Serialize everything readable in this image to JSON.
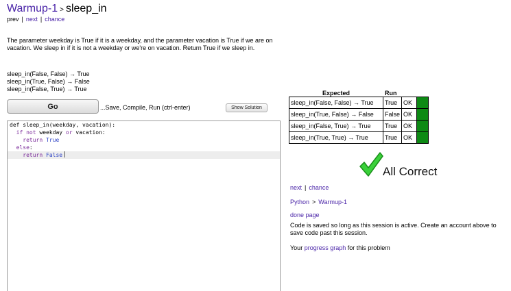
{
  "header": {
    "section": "Warmup-1",
    "separator": ">",
    "problem": "sleep_in"
  },
  "nav_top": {
    "prev": "prev",
    "next": "next",
    "chance": "chance",
    "pipe": "|"
  },
  "description": "The parameter weekday is True if it is a weekday, and the parameter vacation is True if we are on vacation. We sleep in if it is not a weekday or we're on vacation. Return True if we sleep in.",
  "examples": [
    "sleep_in(False, False) → True",
    "sleep_in(True, False) → False",
    "sleep_in(False, True) → True"
  ],
  "actions": {
    "go_label": "Go",
    "go_hint": "...Save, Compile, Run (ctrl-enter)",
    "show_solution": "Show Solution"
  },
  "editor": {
    "lines": [
      [
        {
          "t": "def sleep_in(weekday, vacation):",
          "c": ""
        }
      ],
      [
        {
          "t": "  ",
          "c": ""
        },
        {
          "t": "if",
          "c": "kw"
        },
        {
          "t": " ",
          "c": ""
        },
        {
          "t": "not",
          "c": "kw"
        },
        {
          "t": " weekday ",
          "c": ""
        },
        {
          "t": "or",
          "c": "kw"
        },
        {
          "t": " vacation:",
          "c": ""
        }
      ],
      [
        {
          "t": "    ",
          "c": ""
        },
        {
          "t": "return",
          "c": "kw"
        },
        {
          "t": " ",
          "c": ""
        },
        {
          "t": "True",
          "c": "bi"
        }
      ],
      [
        {
          "t": "  ",
          "c": ""
        },
        {
          "t": "else",
          "c": "kw"
        },
        {
          "t": ":",
          "c": ""
        }
      ],
      [
        {
          "t": "    ",
          "c": ""
        },
        {
          "t": "return",
          "c": "kw"
        },
        {
          "t": " ",
          "c": ""
        },
        {
          "t": "False",
          "c": "bi"
        }
      ]
    ],
    "active_line": 4
  },
  "results": {
    "col_expected": "Expected",
    "col_run": "Run",
    "rows": [
      {
        "expected": "sleep_in(False, False) → True",
        "run": "True",
        "status": "OK"
      },
      {
        "expected": "sleep_in(True, False) → False",
        "run": "False",
        "status": "OK"
      },
      {
        "expected": "sleep_in(False, True) → True",
        "run": "True",
        "status": "OK"
      },
      {
        "expected": "sleep_in(True, True) → True",
        "run": "True",
        "status": "OK"
      }
    ],
    "pass_color": "#0d8a14"
  },
  "verdict": {
    "icon": "checkmark-icon",
    "text": "All Correct",
    "icon_color": "#3ad13a"
  },
  "nav_bottom": {
    "next": "next",
    "chance": "chance",
    "pipe": "|"
  },
  "breadcrumb": {
    "language": "Python",
    "separator": ">",
    "section": "Warmup-1"
  },
  "done_page": "done page",
  "saved_note": "Code is saved so long as this session is active. Create an account above to save code past this session.",
  "progress": {
    "prefix": "Your ",
    "link": "progress graph",
    "suffix": " for this problem"
  },
  "colors": {
    "link": "#4a24a8",
    "keyword": "#7a2a9a",
    "builtin": "#2a3fc4"
  }
}
